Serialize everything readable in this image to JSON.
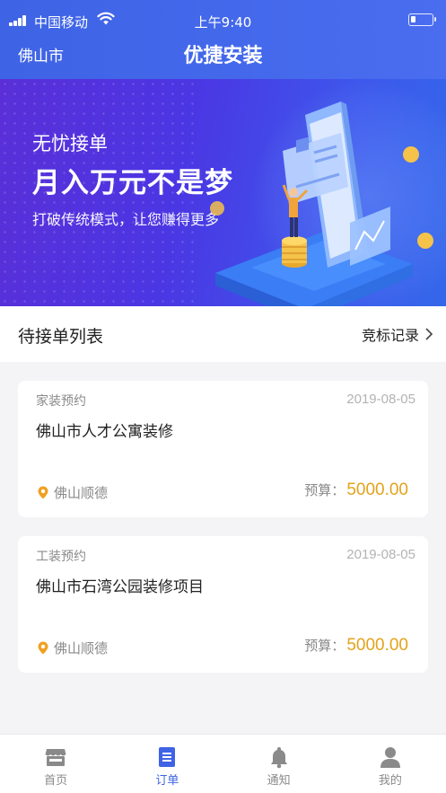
{
  "status_bar": {
    "carrier": "中国移动",
    "time": "上午9:40"
  },
  "header": {
    "city": "佛山市",
    "title": "优捷安装"
  },
  "banner": {
    "subtitle": "无忧接单",
    "headline": "月入万元不是梦",
    "description": "打破传统模式，让您赚得更多"
  },
  "section": {
    "title": "待接单列表",
    "link_label": "竞标记录"
  },
  "orders": [
    {
      "category": "家装预约",
      "date": "2019-08-05",
      "name": "佛山市人才公寓装修",
      "location": "佛山顺德",
      "budget_label": "预算：",
      "budget_value": "5000.00"
    },
    {
      "category": "工装预约",
      "date": "2019-08-05",
      "name": "佛山市石湾公园装修项目",
      "location": "佛山顺德",
      "budget_label": "预算：",
      "budget_value": "5000.00"
    }
  ],
  "tabbar": [
    {
      "label": "首页",
      "icon": "store-icon",
      "active": false
    },
    {
      "label": "订单",
      "icon": "order-list-icon",
      "active": true
    },
    {
      "label": "通知",
      "icon": "bell-icon",
      "active": false
    },
    {
      "label": "我的",
      "icon": "user-icon",
      "active": false
    }
  ],
  "colors": {
    "primary": "#3e63e5",
    "accent_amount": "#e3a31b",
    "location_pin": "#f0a020",
    "tab_inactive": "#8a8a8a"
  }
}
